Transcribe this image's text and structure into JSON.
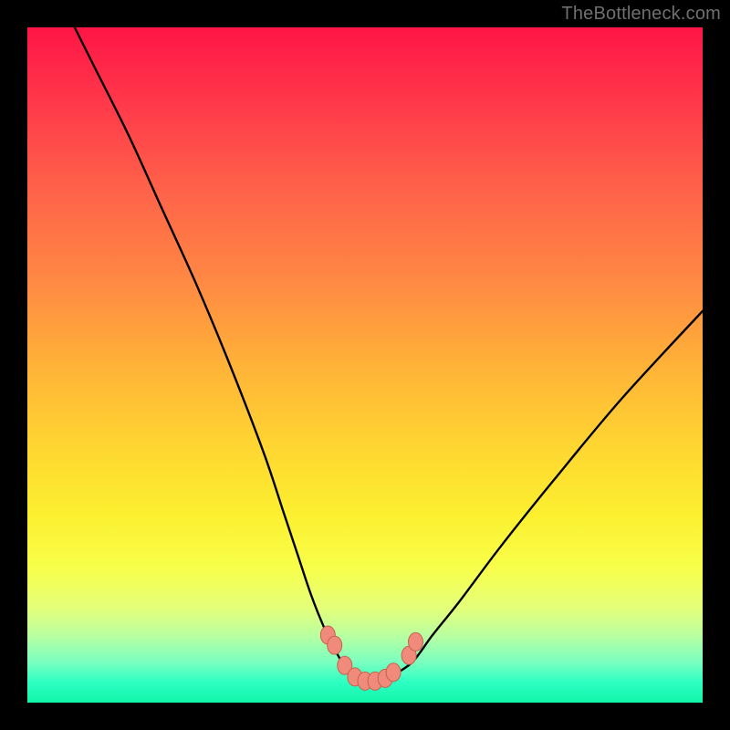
{
  "watermark": "TheBottleneck.com",
  "chart_data": {
    "type": "line",
    "title": "",
    "xlabel": "",
    "ylabel": "",
    "xlim": [
      0,
      100
    ],
    "ylim": [
      0,
      100
    ],
    "series": [
      {
        "name": "bottleneck-curve",
        "x": [
          7,
          10,
          15,
          20,
          25,
          30,
          35,
          38,
          40,
          42,
          44,
          46,
          48,
          50,
          52,
          54,
          57,
          60,
          64,
          70,
          78,
          88,
          100
        ],
        "values": [
          100,
          94,
          84,
          73,
          62,
          50,
          37,
          28,
          22,
          16,
          11,
          7,
          4,
          3,
          3,
          4,
          6,
          10,
          15,
          23,
          33,
          45,
          58
        ]
      }
    ],
    "markers": {
      "name": "highlight-dots",
      "x": [
        44.5,
        45.5,
        47,
        48.5,
        50,
        51.5,
        53,
        54.2,
        56.5,
        57.5
      ],
      "values": [
        10,
        8.5,
        5.5,
        3.8,
        3.2,
        3.2,
        3.6,
        4.5,
        7,
        9
      ]
    },
    "colors": {
      "curve": "#000000",
      "marker_fill": "#f08a7a",
      "marker_stroke": "#c6614e",
      "gradient_top": "#ff1546",
      "gradient_bottom": "#11f6a8"
    }
  }
}
